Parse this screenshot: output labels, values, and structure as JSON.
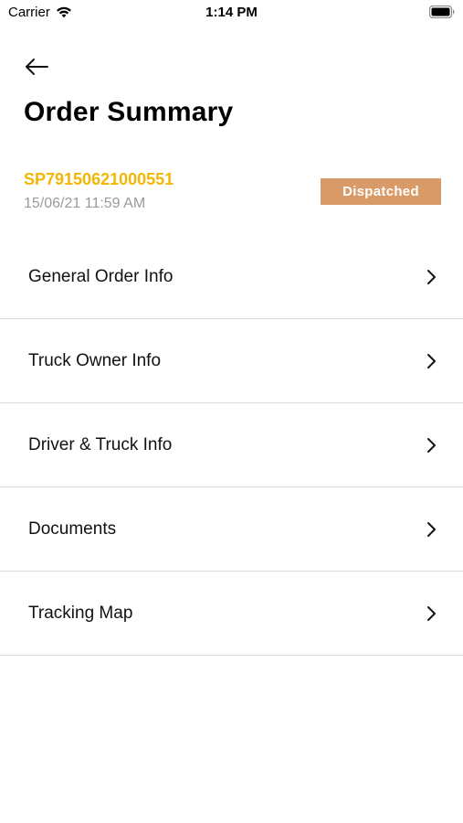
{
  "status_bar": {
    "carrier": "Carrier",
    "time": "1:14 PM",
    "wifi_icon": "wifi-icon",
    "battery_icon": "battery-icon"
  },
  "header": {
    "back_icon": "arrow-left-icon",
    "title": "Order Summary"
  },
  "order": {
    "id": "SP79150621000551",
    "datetime": "15/06/21 11:59 AM",
    "status": "Dispatched"
  },
  "menu": {
    "items": [
      {
        "label": "General Order Info",
        "icon": "chevron-right-icon"
      },
      {
        "label": "Truck Owner Info",
        "icon": "chevron-right-icon"
      },
      {
        "label": "Driver & Truck Info",
        "icon": "chevron-right-icon"
      },
      {
        "label": "Documents",
        "icon": "chevron-right-icon"
      },
      {
        "label": "Tracking Map",
        "icon": "chevron-right-icon"
      }
    ]
  },
  "colors": {
    "accent_yellow": "#F2B705",
    "badge_bg": "#D89A66",
    "divider": "#DCDCDC",
    "muted_text": "#9A9A9A"
  }
}
